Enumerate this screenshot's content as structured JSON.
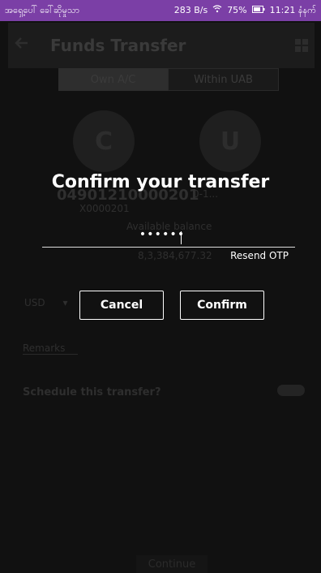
{
  "status_bar": {
    "left_text": "အရှေ့ပေါ် ခေါ်ဆိုမှုသာ",
    "speed": "283 B/s",
    "battery": "75%",
    "time": "11:21 နံနက်"
  },
  "app_bar": {
    "title": "Funds Transfer"
  },
  "segments": {
    "own": "Own A/C",
    "within": "Within UAB"
  },
  "accounts": {
    "from_initial": "C",
    "to_initial": "U",
    "from_number": "04901210000201",
    "from_sub": "X0000201",
    "to_number": "0-1..."
  },
  "balance": {
    "label": "Available balance",
    "amount": "8,3,384,677.32"
  },
  "currency": "USD",
  "remarks_label": "Remarks",
  "schedule_label": "Schedule this transfer?",
  "bottom_button": "Continue",
  "dialog": {
    "title": "Confirm your transfer",
    "otp_value": "••••••",
    "resend": "Resend OTP",
    "cancel": "Cancel",
    "confirm": "Confirm"
  }
}
